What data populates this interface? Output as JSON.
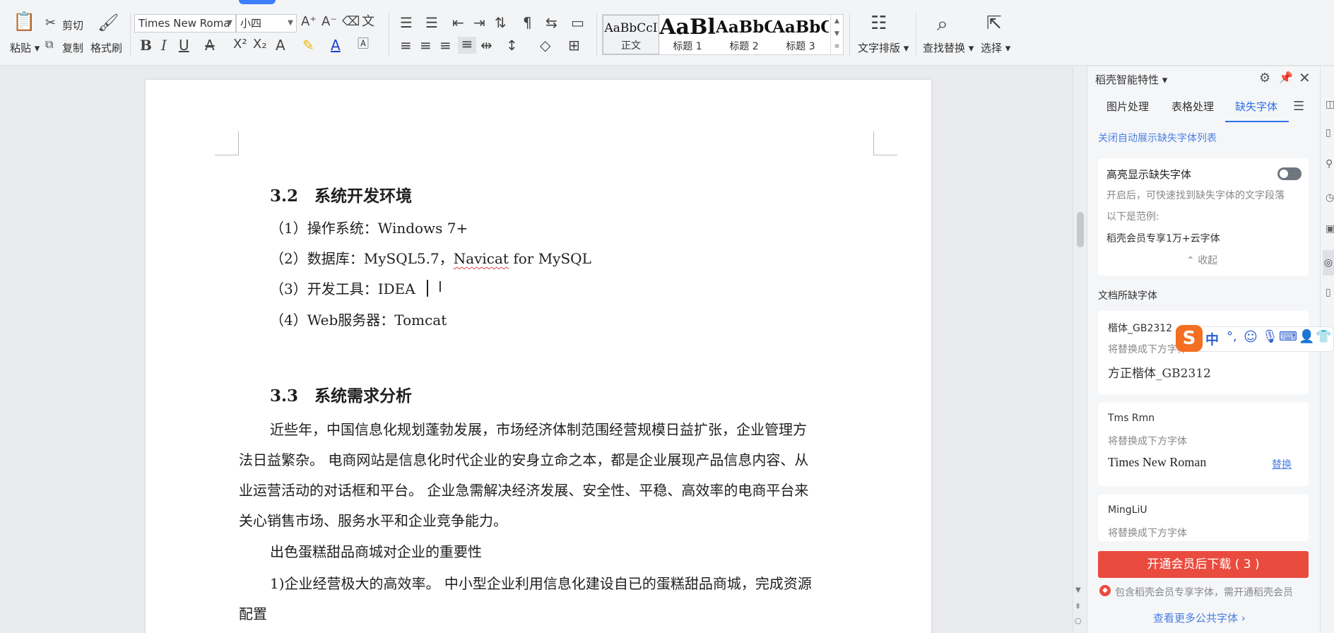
{
  "ribbon": {
    "paste": "粘贴",
    "cut": "剪切",
    "copy": "复制",
    "format_painter": "格式刷",
    "font_name": "Times New Roma",
    "font_size": "小四",
    "styles": [
      {
        "sample": "AaBbCcI",
        "caption": "正文"
      },
      {
        "sample": "AaBl",
        "caption": "标题 1"
      },
      {
        "sample": "AaBbC",
        "caption": "标题 2"
      },
      {
        "sample": "AaBbC",
        "caption": "标题 3"
      }
    ],
    "text_layout": "文字排版",
    "find_replace": "查找替换",
    "select": "选择"
  },
  "document": {
    "h_32": "3.2　系统开发环境",
    "env1_prefix": "（1）操作系统：",
    "env1_value": "Windows 7+",
    "env2_prefix": "（2）数据库：MySQL5.7，",
    "env2_squiggle": "Navicat",
    "env2_suffix": " for MySQL",
    "env3": "（3）开发工具：IDEA",
    "env4": "（4）Web服务器：Tomcat",
    "h_33": "3.3　系统需求分析",
    "para1_line1": "近些年，中国信息化规划蓬勃发展，市场经济体制范围经营规模日益扩张，企业管理方",
    "para1_line2": "法日益繁杂。 电商网站是信息化时代企业的安身立命之本，都是企业展现产品信息内容、从",
    "para1_line3": "业运营活动的对话框和平台。 企业急需解决经济发展、安全性、平稳、高效率的电商平台来",
    "para1_line4": "关心销售市场、服务水平和企业竞争能力。",
    "para2": "出色蛋糕甜品商城对企业的重要性",
    "para3_line1": "1)企业经营极大的高效率。 中小型企业利用信息化建设自已的蛋糕甜品商城，完成资源",
    "para3_line2": "配置"
  },
  "pane": {
    "title": "稻壳智能特性",
    "tabs": [
      "图片处理",
      "表格处理",
      "缺失字体"
    ],
    "close_auto_list": "关闭自动展示缺失字体列表",
    "highlight_title": "高亮显示缺失字体",
    "highlight_desc": "开启后，可快速找到缺失字体的文字段落",
    "example_label": "以下是范例:",
    "example_value": "稻壳会员专享1万+云字体",
    "collapse": "收起",
    "missing_section": "文档所缺字体",
    "fonts": [
      {
        "name": "楷体_GB2312",
        "hint": "将替换成下方字体",
        "replacement": "方正楷体_GB2312",
        "action": ""
      },
      {
        "name": "Tms Rmn",
        "hint": "将替换成下方字体",
        "replacement": "Times New Roman",
        "action": "替换"
      },
      {
        "name": "MingLiU",
        "hint": "将替换成下方字体",
        "replacement": "",
        "action": ""
      }
    ],
    "cta": "开通会员后下载 ( 3 )",
    "notice": "包含稻壳会员专享字体，需开通稻壳会员",
    "more_fonts": "查看更多公共字体"
  },
  "ime": {
    "logo": "S",
    "mode": "中",
    "punct": "°,"
  }
}
